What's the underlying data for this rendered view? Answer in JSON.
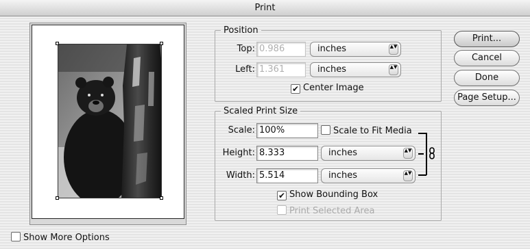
{
  "window": {
    "title": "Print"
  },
  "preview": {
    "image_alt": "black bear photo"
  },
  "position": {
    "legend": "Position",
    "top_label": "Top:",
    "top_value": "0.986",
    "top_unit": "inches",
    "left_label": "Left:",
    "left_value": "1.361",
    "left_unit": "inches",
    "center_image_label": "Center Image",
    "center_image_checked": true
  },
  "scaled": {
    "legend": "Scaled Print Size",
    "scale_label": "Scale:",
    "scale_value": "100%",
    "scale_to_fit_label": "Scale to Fit Media",
    "scale_to_fit_checked": false,
    "height_label": "Height:",
    "height_value": "8.333",
    "height_unit": "inches",
    "width_label": "Width:",
    "width_value": "5.514",
    "width_unit": "inches",
    "show_bounding_box_label": "Show Bounding Box",
    "show_bounding_box_checked": true,
    "print_selected_area_label": "Print Selected Area",
    "print_selected_area_checked": false
  },
  "buttons": {
    "print": "Print...",
    "cancel": "Cancel",
    "done": "Done",
    "page_setup": "Page Setup..."
  },
  "options": {
    "show_more_options_label": "Show More Options",
    "show_more_options_checked": false
  },
  "glyphs": {
    "check": "✔",
    "arrows": "▲▼",
    "link": "🔗"
  }
}
